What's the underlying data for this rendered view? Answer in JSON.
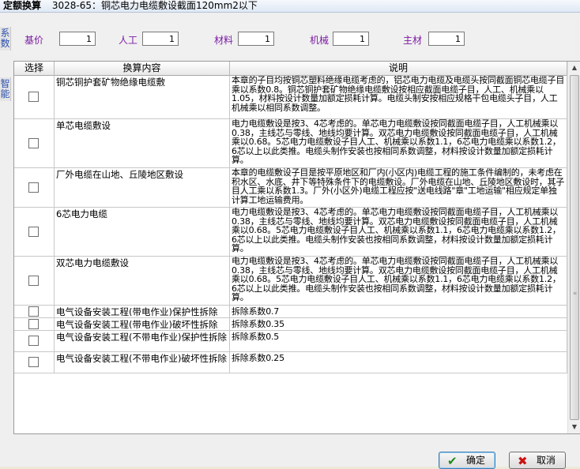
{
  "window": {
    "app_title": "定额换算",
    "subtitle": "3028-65：铜芯电力电缆敷设截面120mm2以下"
  },
  "side_tabs": {
    "coef": "系数",
    "smart": "智能"
  },
  "coefficients": [
    {
      "label": "基价",
      "value": "1"
    },
    {
      "label": "人工",
      "value": "1"
    },
    {
      "label": "材料",
      "value": "1"
    },
    {
      "label": "机械",
      "value": "1"
    },
    {
      "label": "主材",
      "value": "1"
    }
  ],
  "table": {
    "headers": {
      "select": "选择",
      "content": "换算内容",
      "desc": "说明"
    },
    "rows": [
      {
        "name": "铜芯铜护套矿物绝缘电缆敷",
        "checked": false,
        "desc": "本章的子目均按铜芯塑料绝缘电缆考虑的，铝芯电力电缆及电缆头按同截面铜芯电缆子目乘以系数0.8。铜芯铜护套矿物绝缘电缆敷设按相应截面电缆子目，人工、机械乘以1.05，材料按设计数量加额定损耗计算。电缆头制安按相应规格干包电缆头子目，人工机械乘以相同系数调整。"
      },
      {
        "name": "单芯电缆敷设",
        "checked": false,
        "desc": "电力电缆敷设是按3、4芯考虑的。单芯电力电缆敷设按同截面电缆子目，人工机械乘以0.38，主线芯与零线、地线均要计算。双芯电力电缆敷设按同截面电缆子目，人工机械乘以0.68。5芯电力电缆敷设子目人工、机械乘以系数1.1，6芯电力电缆乘以系数1.2，6芯以上以此类推。电缆头制作安装也按相同系数调整，材料按设计数量加额定损耗计算。"
      },
      {
        "name": "厂外电缆在山地、丘陵地区敷设",
        "checked": false,
        "desc": "本章的电缆敷设子目是按平原地区和厂内(小区内)电缆工程的施工条件编制的，未考虑在积水区、水底、井下等特殊条件下的电缆敷设。厂外电缆在山地、丘陵地区敷设时，其子目人工乘以系数1.3。厂外(小区外)电缆工程应按\"送电线路\"章\"工地运输\"相应规定单独计算工地运输费用。"
      },
      {
        "name": "6芯电力电缆",
        "checked": false,
        "desc": "电力电缆敷设是按3、4芯考虑的。单芯电力电缆敷设按同截面电缆子目，人工机械乘以0.38，主线芯与零线、地线均要计算。双芯电力电缆敷设按同截面电缆子目，人工机械乘以0.68。5芯电力电缆敷设子目人工、机械乘以系数1.1，6芯电力电缆乘以系数1.2，6芯以上以此类推。电缆头制作安装也按相同系数调整，材料按设计数量加额定损耗计算。"
      },
      {
        "name": "双芯电力电缆敷设",
        "checked": false,
        "desc": "电力电缆敷设是按3、4芯考虑的。单芯电力电缆敷设按同截面电缆子目，人工机械乘以0.38，主线芯与零线、地线均要计算。双芯电力电缆敷设按同截面电缆子目，人工机械乘以0.68。5芯电力电缆敷设子目人工、机械乘以系数1.1，6芯电力电缆乘以系数1.2，6芯以上以此类推。电缆头制作安装也按相同系数调整，材料按设计数量加额定损耗计算。"
      },
      {
        "name": "电气设备安装工程(带电作业)保护性拆除",
        "checked": false,
        "desc": "拆除系数0.7"
      },
      {
        "name": "电气设备安装工程(带电作业)破坏性拆除",
        "checked": false,
        "desc": "拆除系数0.35"
      },
      {
        "name": "电气设备安装工程(不带电作业)保护性拆除",
        "checked": false,
        "desc": "拆除系数0.5"
      },
      {
        "name": "电气设备安装工程(不带电作业)破坏性拆除",
        "checked": false,
        "desc": "拆除系数0.25"
      }
    ]
  },
  "buttons": {
    "ok": "确定",
    "cancel": "取消"
  },
  "icons": {
    "ok": "checkmark-icon",
    "cancel": "cross-icon"
  },
  "colors": {
    "label": "#7b1aa2",
    "ok_icon": "#1e8a1e",
    "cancel_icon": "#cc1111"
  }
}
